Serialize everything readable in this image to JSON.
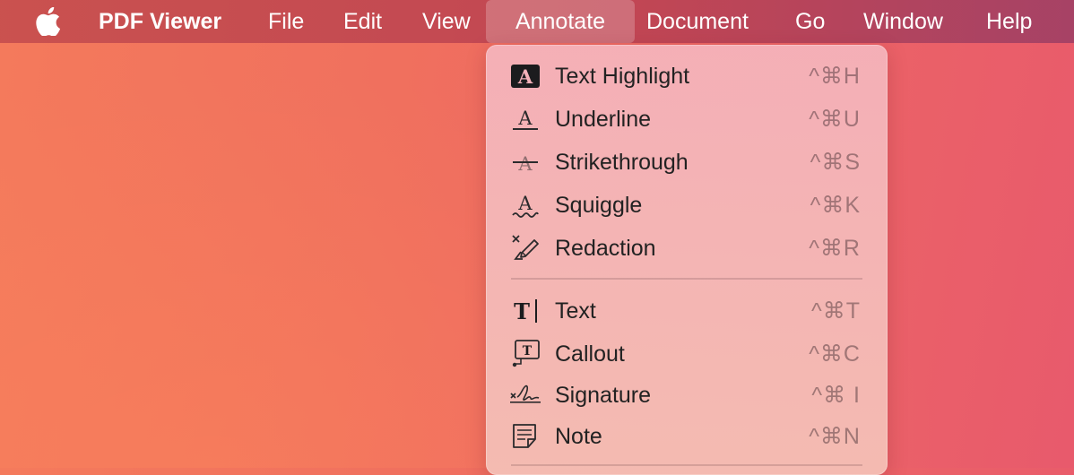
{
  "menubar": {
    "app_name": "PDF Viewer",
    "items": [
      "File",
      "Edit",
      "View",
      "Annotate",
      "Document",
      "Go",
      "Window",
      "Help"
    ],
    "active_item": "Annotate"
  },
  "dropdown": {
    "items": [
      {
        "label": "Text Highlight",
        "shortcut": "^⌘H",
        "icon": "text-highlight-icon"
      },
      {
        "label": "Underline",
        "shortcut": "^⌘U",
        "icon": "underline-icon"
      },
      {
        "label": "Strikethrough",
        "shortcut": "^⌘S",
        "icon": "strikethrough-icon"
      },
      {
        "label": "Squiggle",
        "shortcut": "^⌘K",
        "icon": "squiggle-icon"
      },
      {
        "label": "Redaction",
        "shortcut": "^⌘R",
        "icon": "redaction-icon"
      },
      {
        "label": "Text",
        "shortcut": "^⌘T",
        "icon": "text-box-icon"
      },
      {
        "label": "Callout",
        "shortcut": "^⌘C",
        "icon": "callout-icon"
      },
      {
        "label": "Signature",
        "shortcut": "^⌘ I",
        "icon": "signature-icon"
      },
      {
        "label": "Note",
        "shortcut": "^⌘N",
        "icon": "note-icon"
      }
    ]
  },
  "colors": {
    "desktop_start": "#f47a5c",
    "desktop_end": "#e85a6c",
    "menu_text": "#ffffff",
    "dropdown_bg": "#f5b2ba"
  }
}
